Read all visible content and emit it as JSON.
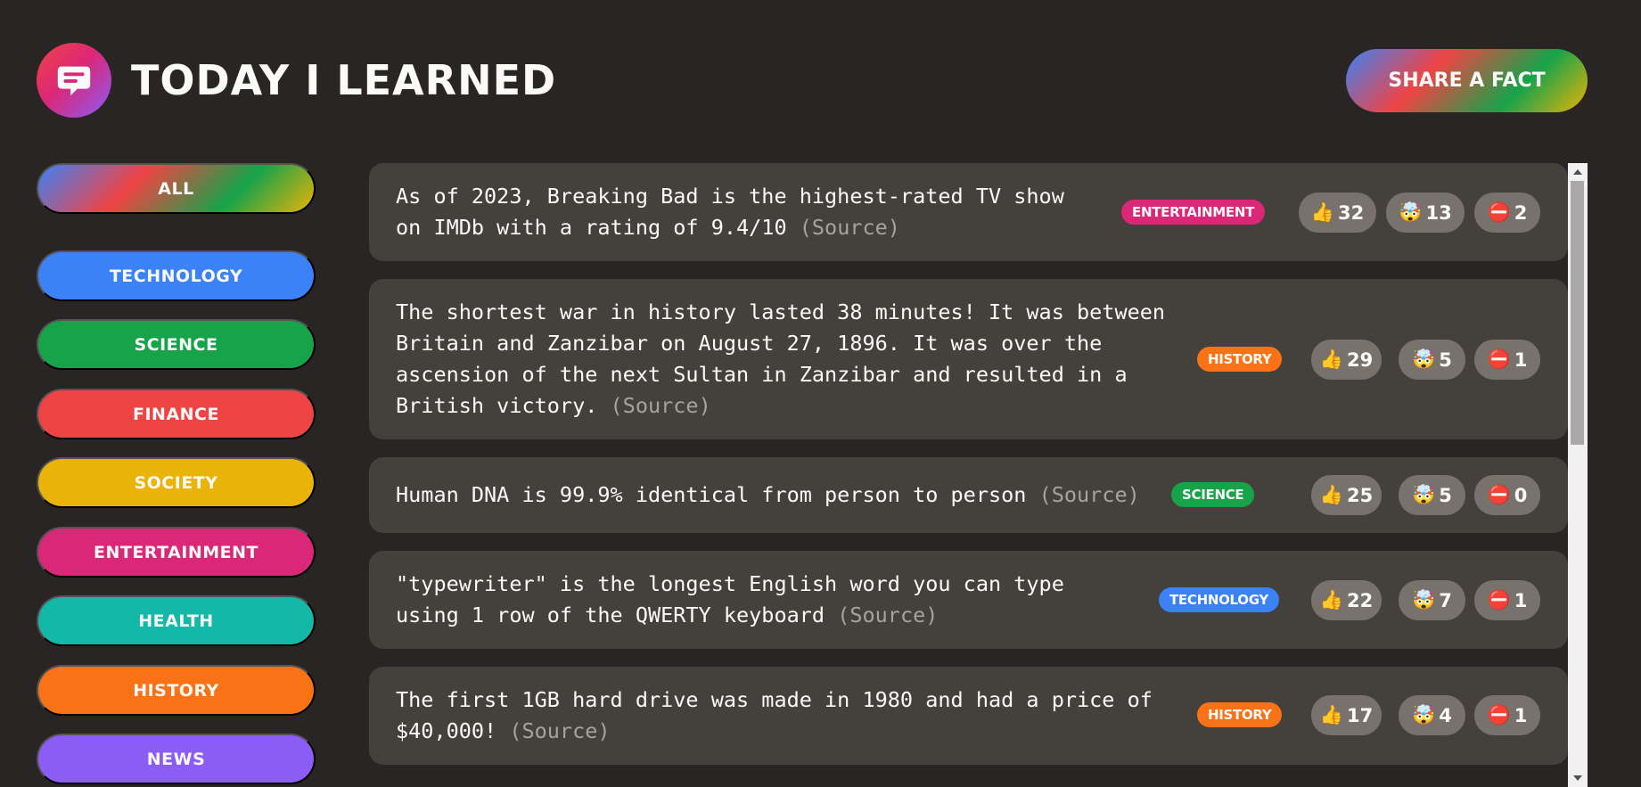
{
  "header": {
    "title": "Today I Learned",
    "share_label": "Share a fact",
    "logo_icon": "message-bubble-icon"
  },
  "sidebar": {
    "items": [
      {
        "label": "All",
        "color": "gradient"
      },
      {
        "label": "Technology",
        "color": "#3b82f6"
      },
      {
        "label": "Science",
        "color": "#16a34a"
      },
      {
        "label": "Finance",
        "color": "#ef4444"
      },
      {
        "label": "Society",
        "color": "#eab308"
      },
      {
        "label": "Entertainment",
        "color": "#db2777"
      },
      {
        "label": "Health",
        "color": "#14b8a6"
      },
      {
        "label": "History",
        "color": "#f97316"
      },
      {
        "label": "News",
        "color": "#8b5cf6"
      }
    ]
  },
  "facts": [
    {
      "text": "As of 2023, Breaking Bad is the highest-rated TV show on IMDb with a rating of 9.4/10",
      "source": "(Source)",
      "category": "Entertainment",
      "category_color": "#db2777",
      "votes_interesting": "32",
      "votes_mindblowing": "13",
      "votes_false": "2"
    },
    {
      "text": "The shortest war in history lasted 38 minutes! It was between Britain and Zanzibar on August 27, 1896. It was over the ascension of the next Sultan in Zanzibar and resulted in a British victory.",
      "source": "(Source)",
      "category": "History",
      "category_color": "#f97316",
      "votes_interesting": "29",
      "votes_mindblowing": "5",
      "votes_false": "1"
    },
    {
      "text": "Human DNA is 99.9% identical from person to person",
      "source": "(Source)",
      "category": "Science",
      "category_color": "#16a34a",
      "votes_interesting": "25",
      "votes_mindblowing": "5",
      "votes_false": "0"
    },
    {
      "text": "\"typewriter\" is the longest English word you can type using 1 row of the QWERTY keyboard",
      "source": "(Source)",
      "category": "Technology",
      "category_color": "#3b82f6",
      "votes_interesting": "22",
      "votes_mindblowing": "7",
      "votes_false": "1"
    },
    {
      "text": "The first 1GB hard drive was made in 1980 and had a price of $40,000!",
      "source": "(Source)",
      "category": "History",
      "category_color": "#f97316",
      "votes_interesting": "17",
      "votes_mindblowing": "4",
      "votes_false": "1"
    }
  ],
  "vote_icons": {
    "interesting": "👍",
    "mindblowing": "🤯",
    "false": "⛔"
  }
}
